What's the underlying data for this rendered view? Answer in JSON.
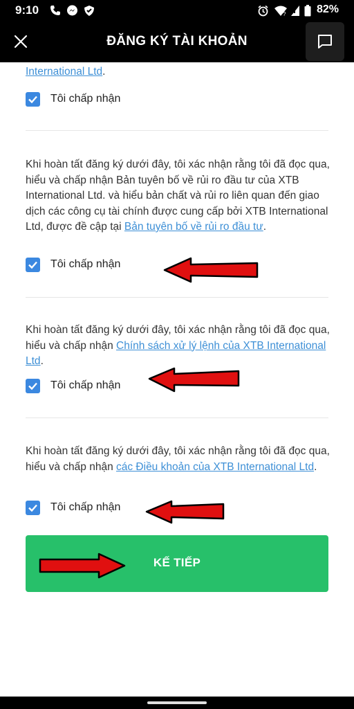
{
  "status_bar": {
    "time": "9:10",
    "battery": "82%",
    "icons": [
      "phone-icon",
      "messenger-icon",
      "shield-icon",
      "alarm-icon",
      "wifi-icon",
      "signal-icon",
      "battery-icon"
    ]
  },
  "header": {
    "title": "ĐĂNG KÝ TÀI KHOẢN",
    "close_icon": "close-icon",
    "chat_icon": "chat-icon"
  },
  "sections": [
    {
      "partial_link": "International Ltd",
      "partial_suffix": ".",
      "checkbox_label": "Tôi chấp nhận",
      "checked": true
    },
    {
      "text": "Khi hoàn tất đăng ký dưới đây, tôi xác nhận rằng tôi đã đọc qua, hiểu và chấp nhận Bản tuyên bố về rủi ro đầu tư của XTB International Ltd. và hiểu bản chất và rủi ro liên quan đến giao dịch các công cụ tài chính được cung cấp bởi XTB International Ltd, được đề cập tại ",
      "link": "Bản tuyên bố về rủi ro đầu tư",
      "suffix": ".",
      "checkbox_label": "Tôi chấp nhận",
      "checked": true
    },
    {
      "text": "Khi hoàn tất đăng ký dưới đây, tôi xác nhận rằng tôi đã đọc qua, hiểu và chấp nhận ",
      "link": "Chính sách xử lý lệnh của XTB International Ltd",
      "suffix": ".",
      "checkbox_label": "Tôi chấp nhận",
      "checked": true
    },
    {
      "text": "Khi hoàn tất đăng ký dưới đây, tôi xác nhận rằng tôi đã đọc qua, hiểu và chấp nhận ",
      "link": "các Điều khoản của XTB International Ltd",
      "suffix": ".",
      "checkbox_label": "Tôi chấp nhận",
      "checked": true
    }
  ],
  "next_button": {
    "label": "KẾ TIẾP"
  },
  "colors": {
    "accent_green": "#27c06a",
    "checkbox_blue": "#3b88e0",
    "link_blue": "#3d8fd6",
    "arrow_red": "#e01010"
  }
}
